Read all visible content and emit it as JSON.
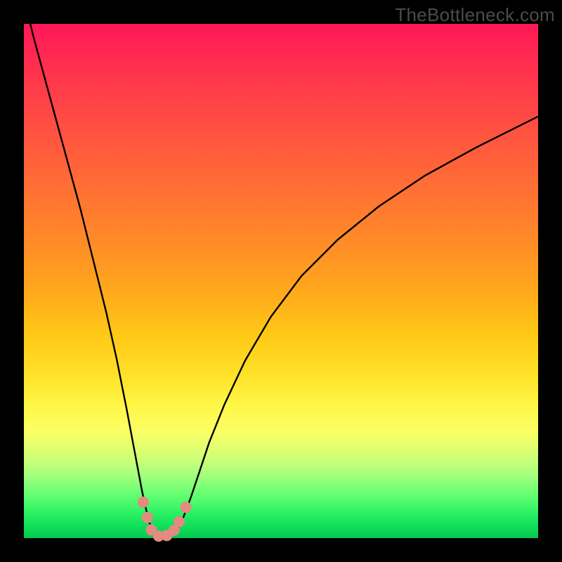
{
  "watermark": "TheBottleneck.com",
  "colors": {
    "background": "#000000",
    "gradient_top": "#ff1858",
    "gradient_bottom": "#05c84f",
    "curve": "#000000",
    "beads": "#e48a80"
  },
  "chart_data": {
    "type": "line",
    "title": "",
    "xlabel": "",
    "ylabel": "",
    "xlim": [
      0,
      100
    ],
    "ylim": [
      0,
      100
    ],
    "annotations": [
      "TheBottleneck.com"
    ],
    "series": [
      {
        "name": "curve",
        "x": [
          0,
          2,
          5,
          8,
          11,
          14,
          16,
          18,
          20,
          21.5,
          23,
          24.3,
          25.2,
          26,
          27,
          28,
          29,
          30,
          31,
          32.5,
          34,
          36,
          39,
          43,
          48,
          54,
          61,
          69,
          78,
          88,
          100
        ],
        "y": [
          105,
          97,
          86,
          75,
          64,
          52,
          44,
          35,
          25,
          17,
          9,
          3.2,
          1.2,
          0.5,
          0.3,
          0.4,
          0.9,
          2,
          4,
          8,
          12.5,
          18.5,
          26,
          34.5,
          43,
          51,
          58,
          64.5,
          70.5,
          76,
          82
        ]
      }
    ],
    "markers": [
      {
        "x": 23.2,
        "y": 7.0
      },
      {
        "x": 24.0,
        "y": 4.0
      },
      {
        "x": 24.8,
        "y": 1.6
      },
      {
        "x": 26.2,
        "y": 0.4
      },
      {
        "x": 27.8,
        "y": 0.5
      },
      {
        "x": 29.2,
        "y": 1.5
      },
      {
        "x": 30.2,
        "y": 3.2
      },
      {
        "x": 31.5,
        "y": 6.0
      }
    ]
  }
}
